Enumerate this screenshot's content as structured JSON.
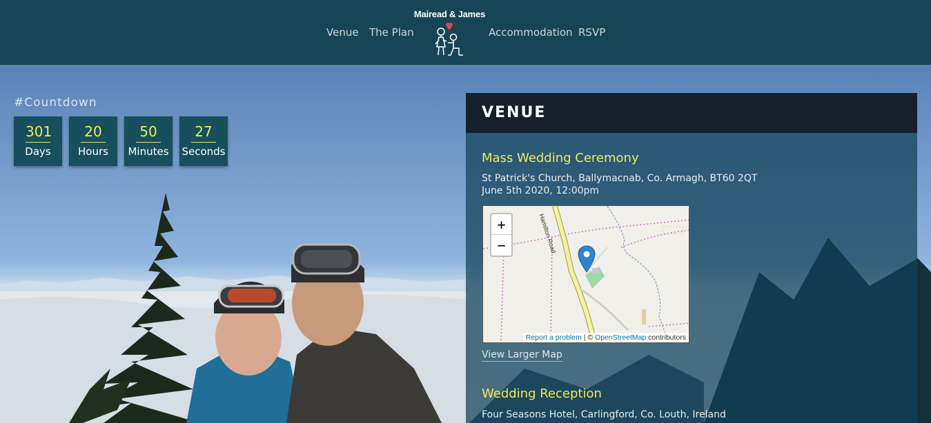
{
  "header": {
    "brand": "Mairead & James",
    "nav": [
      "Venue",
      "The Plan",
      "Accommodation",
      "RSVP"
    ],
    "logo_icon": "proposal-couple-icon"
  },
  "countdown": {
    "heading": "#Countdown",
    "items": [
      {
        "value": "301",
        "unit": "Days"
      },
      {
        "value": "20",
        "unit": "Hours"
      },
      {
        "value": "50",
        "unit": "Minutes"
      },
      {
        "value": "27",
        "unit": "Seconds"
      }
    ]
  },
  "venue": {
    "title": "VENUE",
    "ceremony": {
      "title": "Mass Wedding Ceremony",
      "address": "St Patrick's Church, Ballymacnab, Co. Armagh, BT60 2QT",
      "datetime": "June 5th 2020, 12:00pm"
    },
    "map": {
      "zoom_in": "+",
      "zoom_out": "−",
      "road_label": "Hamilton Road",
      "report": "Report a problem",
      "separator": "| ©",
      "osm": "OpenStreetMap",
      "contributors": "contributors",
      "pin_icon": "map-pin-icon"
    },
    "larger_map": "View Larger Map",
    "reception": {
      "title": "Wedding Reception",
      "address": "Four Seasons Hotel, Carlingford, Co. Louth, Ireland"
    }
  },
  "colors": {
    "header_bg": "#164656",
    "accent_yellow": "#f2ea56",
    "panel_head": "#16202c",
    "countdown_box": "#174f5e"
  }
}
